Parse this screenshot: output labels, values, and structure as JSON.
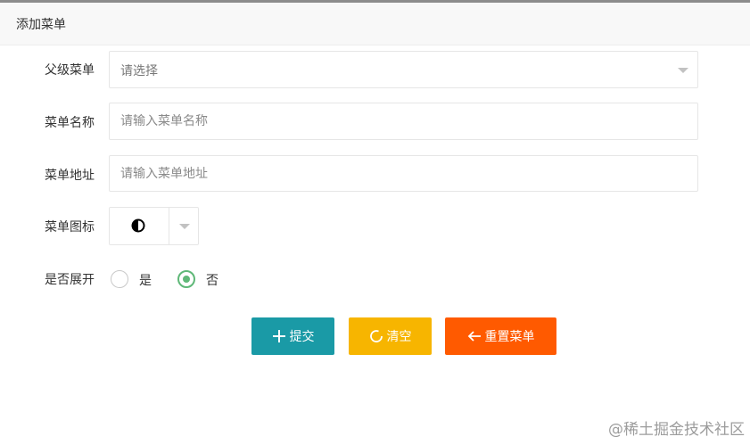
{
  "header": {
    "title": "添加菜单"
  },
  "form": {
    "parent_menu": {
      "label": "父级菜单",
      "placeholder": "请选择"
    },
    "menu_name": {
      "label": "菜单名称",
      "placeholder": "请输入菜单名称"
    },
    "menu_url": {
      "label": "菜单地址",
      "placeholder": "请输入菜单地址"
    },
    "menu_icon": {
      "label": "菜单图标",
      "selected_icon": "half-circle-icon"
    },
    "expand": {
      "label": "是否展开",
      "options": [
        {
          "label": "是",
          "checked": false
        },
        {
          "label": "否",
          "checked": true
        }
      ]
    }
  },
  "buttons": {
    "submit": "提交",
    "clear": "清空",
    "reset": "重置菜单"
  },
  "colors": {
    "submit": "#1a9aa6",
    "clear": "#f7b500",
    "reset": "#ff5a00",
    "radio_checked": "#5fb878"
  },
  "watermark": "@稀土掘金技术社区"
}
